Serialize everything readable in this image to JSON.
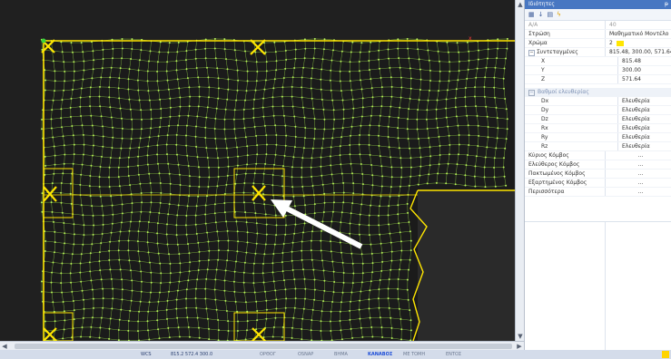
{
  "panel": {
    "title": "Ιδιότητες",
    "pin": "ᵽ",
    "toolbar_icons": [
      "sort-alpha-icon",
      "sort-category-icon",
      "grid-icon",
      "lightning-icon"
    ],
    "rows": [
      {
        "k": "Α/Α",
        "v": "40",
        "grey": true
      },
      {
        "k": "Στρώση",
        "v": "Μαθηματικό Μοντέλο"
      },
      {
        "k": "Χρώμα",
        "v": "2",
        "swatch": true
      }
    ],
    "coords": {
      "label": "Συντεταγμένες",
      "value": "815.48, 300.00, 571.64",
      "children": [
        {
          "k": "X",
          "v": "815.48"
        },
        {
          "k": "Y",
          "v": "300.00"
        },
        {
          "k": "Z",
          "v": "571.64"
        }
      ]
    },
    "dof": {
      "label": "Βαθμοί ελευθερίας",
      "rows": [
        {
          "k": "Dx",
          "v": "Ελευθερία"
        },
        {
          "k": "Dy",
          "v": "Ελευθερία"
        },
        {
          "k": "Dz",
          "v": "Ελευθερία"
        },
        {
          "k": "Rx",
          "v": "Ελευθερία"
        },
        {
          "k": "Ry",
          "v": "Ελευθερία"
        },
        {
          "k": "Rz",
          "v": "Ελευθερία"
        }
      ]
    },
    "nodes": [
      {
        "k": "Κύριος Κόμβος",
        "v": "..."
      },
      {
        "k": "Ελεύθερος Κόμβος",
        "v": "..."
      },
      {
        "k": "Πακτωμένος Κόμβος",
        "v": "..."
      },
      {
        "k": "Εξαρτημένος Κόμβος",
        "v": "..."
      },
      {
        "k": "Περισσότερα",
        "v": "..."
      }
    ]
  },
  "status": {
    "wcs": "WCS",
    "coords": "815.2  572.4  300.0",
    "ortho": "ΟΡΘΟΓ",
    "osnap": "OSNAP",
    "grid": "ΒΗΜΑ",
    "snap": "ΚΑΝΑΒΟΣ",
    "section": "ΜΕ ΤΟΜΗ",
    "polar": "ΕΝΤΟΣ"
  },
  "colors": {
    "mesh": "#a7e04a",
    "highlight": "#ffe600",
    "panel_header": "#4877c2"
  }
}
